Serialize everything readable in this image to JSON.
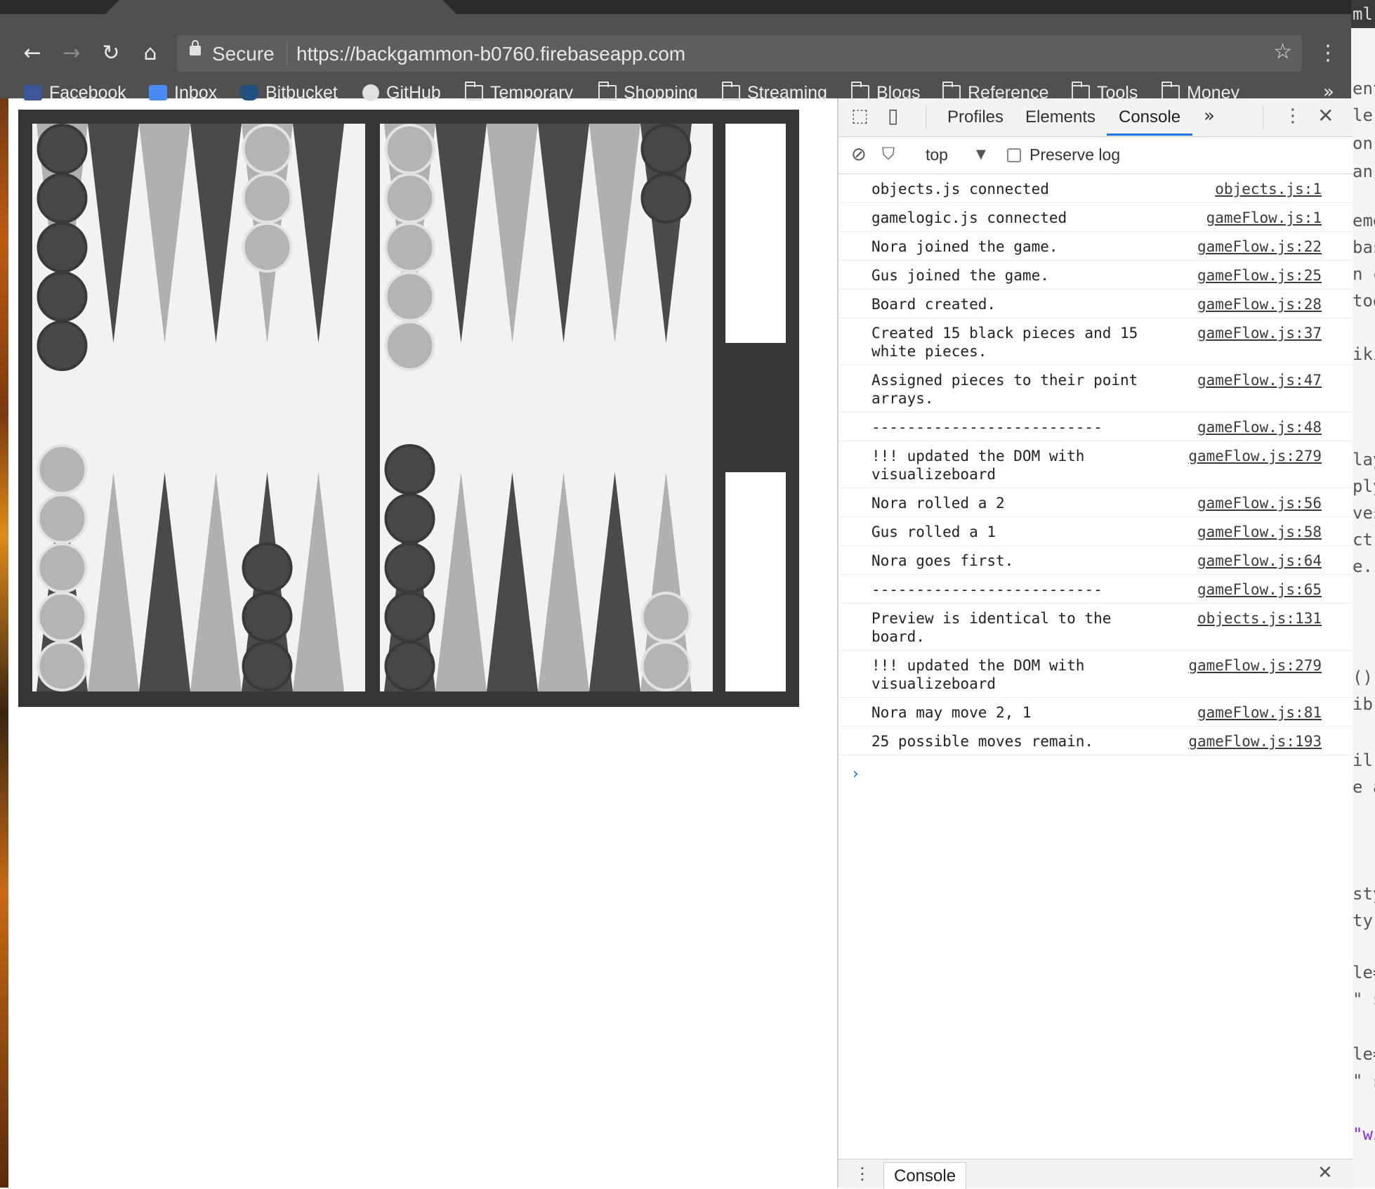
{
  "browser": {
    "secure_label": "Secure",
    "url": "https://backgammon-b0760.firebaseapp.com",
    "bookmarks": [
      "Facebook",
      "Inbox",
      "Bitbucket",
      "GitHub",
      "Temporary",
      "Shopping",
      "Streaming",
      "Blogs",
      "Reference",
      "Tools",
      "Money"
    ],
    "more_bookmarks": "»"
  },
  "board": {
    "top_left_points": [
      {
        "color": "black",
        "count": 5
      },
      {
        "color": null,
        "count": 0
      },
      {
        "color": null,
        "count": 0
      },
      {
        "color": null,
        "count": 0
      },
      {
        "color": "white",
        "count": 3
      },
      {
        "color": null,
        "count": 0
      }
    ],
    "top_right_points": [
      {
        "color": "white",
        "count": 5
      },
      {
        "color": null,
        "count": 0
      },
      {
        "color": null,
        "count": 0
      },
      {
        "color": null,
        "count": 0
      },
      {
        "color": null,
        "count": 0
      },
      {
        "color": "black",
        "count": 2
      }
    ],
    "bottom_left_points": [
      {
        "color": "white",
        "count": 5
      },
      {
        "color": null,
        "count": 0
      },
      {
        "color": null,
        "count": 0
      },
      {
        "color": null,
        "count": 0
      },
      {
        "color": "black",
        "count": 3
      },
      {
        "color": null,
        "count": 0
      }
    ],
    "bottom_right_points": [
      {
        "color": "black",
        "count": 5
      },
      {
        "color": null,
        "count": 0
      },
      {
        "color": null,
        "count": 0
      },
      {
        "color": null,
        "count": 0
      },
      {
        "color": null,
        "count": 0
      },
      {
        "color": "white",
        "count": 2
      }
    ],
    "colors": {
      "dark_point": "#4a4a4a",
      "light_point": "#b0b0b0",
      "black_piece": "#474747",
      "white_piece": "#b4b4b4"
    }
  },
  "devtools": {
    "tabs": [
      "Profiles",
      "Elements",
      "Console"
    ],
    "active_tab": "Console",
    "more_tabs": "»",
    "context": "top",
    "preserve_log_label": "Preserve log",
    "messages": [
      {
        "text": "objects.js connected",
        "source": "objects.js:1"
      },
      {
        "text": "gamelogic.js connected",
        "source": "gameFlow.js:1"
      },
      {
        "text": "Nora joined the game.",
        "source": "gameFlow.js:22"
      },
      {
        "text": "Gus joined the game.",
        "source": "gameFlow.js:25"
      },
      {
        "text": "Board created.",
        "source": "gameFlow.js:28"
      },
      {
        "text": "Created 15 black pieces and 15 white pieces.",
        "source": "gameFlow.js:37"
      },
      {
        "text": "Assigned pieces to their point arrays.",
        "source": "gameFlow.js:47"
      },
      {
        "text": "--------------------------",
        "source": "gameFlow.js:48"
      },
      {
        "text": "!!! updated the DOM with visualizeboard",
        "source": "gameFlow.js:279"
      },
      {
        "text": "Nora rolled a 2",
        "source": "gameFlow.js:56"
      },
      {
        "text": "Gus rolled a 1",
        "source": "gameFlow.js:58"
      },
      {
        "text": "Nora goes first.",
        "source": "gameFlow.js:64"
      },
      {
        "text": "--------------------------",
        "source": "gameFlow.js:65"
      },
      {
        "text": "Preview is identical to the board.",
        "source": "objects.js:131"
      },
      {
        "text": "!!! updated the DOM with visualizeboard",
        "source": "gameFlow.js:279"
      },
      {
        "text": "Nora may move 2, 1",
        "source": "gameFlow.js:81"
      },
      {
        "text": "25 possible moves remain.",
        "source": "gameFlow.js:193"
      }
    ],
    "prompt": "›",
    "drawer_tab": "Console"
  },
  "behind_window": {
    "title_fragment": "ml",
    "lines": [
      "ent",
      "le",
      "on",
      "an",
      "eme",
      "bas",
      "n c",
      "toe",
      "iki",
      "lay",
      "ply",
      "ves",
      "ct",
      "e.",
      "()",
      "ibr",
      "il",
      "e a",
      "sty",
      "ty",
      "le=",
      "\" s",
      "le=",
      "\" s",
      "\"wi"
    ]
  }
}
